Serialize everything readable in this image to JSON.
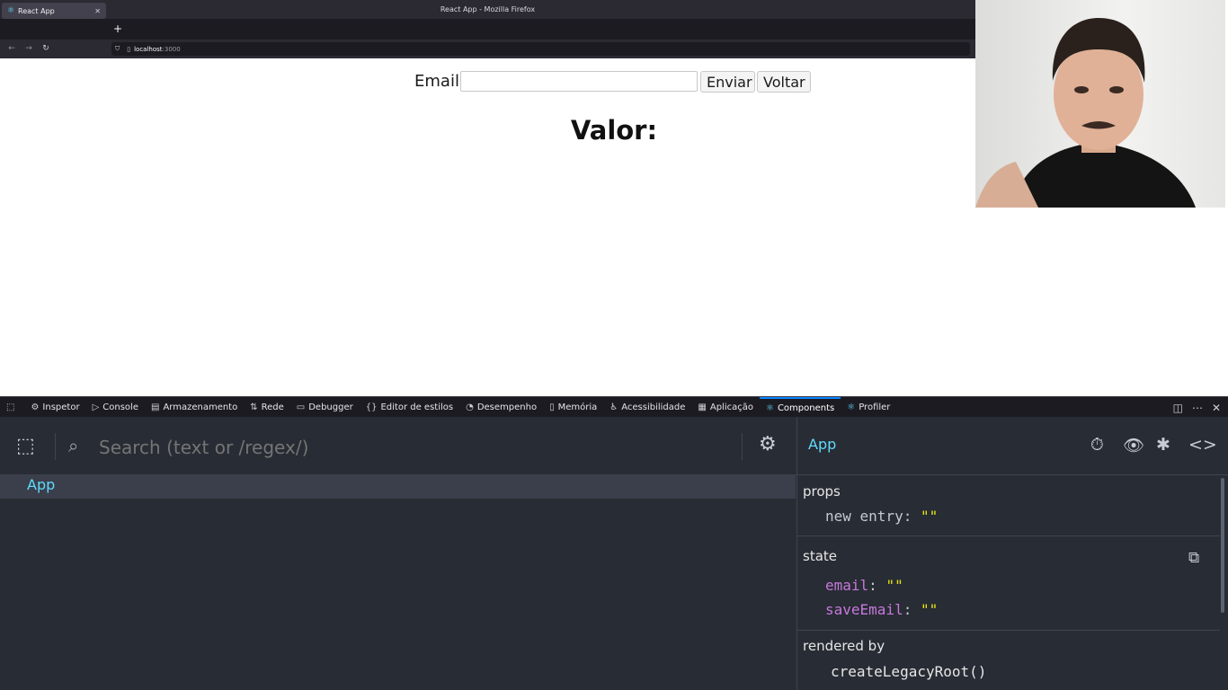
{
  "browser": {
    "window_title": "React App - Mozilla Firefox",
    "tab_title": "React App",
    "url_host": "localhost",
    "url_port": ":3000"
  },
  "page": {
    "email_label": "Email",
    "email_value": "",
    "enviar_label": "Enviar",
    "voltar_label": "Voltar",
    "valor_heading": "Valor:"
  },
  "devtools": {
    "tabs": [
      {
        "label": "Inspetor",
        "icon": "inspector-icon"
      },
      {
        "label": "Console",
        "icon": "console-icon"
      },
      {
        "label": "Armazenamento",
        "icon": "storage-icon"
      },
      {
        "label": "Rede",
        "icon": "network-icon"
      },
      {
        "label": "Debugger",
        "icon": "debugger-icon"
      },
      {
        "label": "Editor de estilos",
        "icon": "style-editor-icon"
      },
      {
        "label": "Desempenho",
        "icon": "performance-icon"
      },
      {
        "label": "Memória",
        "icon": "memory-icon"
      },
      {
        "label": "Acessibilidade",
        "icon": "accessibility-icon"
      },
      {
        "label": "Aplicação",
        "icon": "application-icon"
      },
      {
        "label": "Components",
        "icon": "react-icon"
      },
      {
        "label": "Profiler",
        "icon": "react-icon"
      }
    ],
    "active_tab": "Components"
  },
  "components": {
    "search_placeholder": "Search (text or /regex/)",
    "tree": [
      {
        "name": "App"
      }
    ],
    "selected_component": "App",
    "props_title": "props",
    "props": [
      {
        "key": "new entry",
        "value": "\"\""
      }
    ],
    "state_title": "state",
    "state": [
      {
        "key": "email",
        "value": "\"\""
      },
      {
        "key": "saveEmail",
        "value": "\"\""
      }
    ],
    "rendered_by_title": "rendered by",
    "rendered_by": "createLegacyRoot()"
  },
  "colors": {
    "react_accent": "#61dafb",
    "devtools_bg": "#282c34",
    "string_value": "#e5e510",
    "state_key": "#c678dd"
  }
}
